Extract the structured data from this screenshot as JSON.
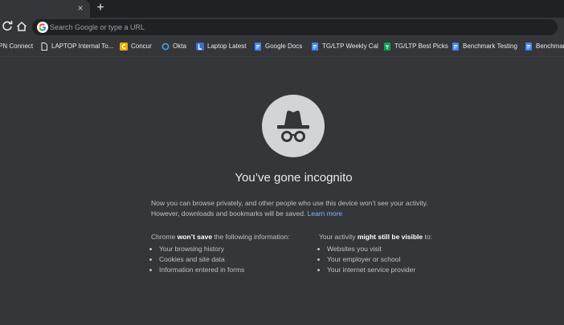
{
  "tabs": {
    "close_symbol": "×",
    "new_tab_symbol": "+"
  },
  "toolbar": {
    "omnibox_placeholder": "Search Google or type a URL",
    "icons": [
      "reload-icon",
      "home-icon",
      "google-icon"
    ]
  },
  "bookmarks": [
    {
      "label": "PN Connect",
      "icon": "none"
    },
    {
      "label": "LAPTOP Internal To...",
      "icon": "page-icon"
    },
    {
      "label": "Concur",
      "icon": "concur-icon"
    },
    {
      "label": "Okta",
      "icon": "okta-icon"
    },
    {
      "label": "Laptop Latest",
      "icon": "blue-l-icon"
    },
    {
      "label": "Google Docs",
      "icon": "docs-icon"
    },
    {
      "label": "TG/LTP Weekly Cal",
      "icon": "docs-icon"
    },
    {
      "label": "TG/LTP Best Picks",
      "icon": "sheets-icon"
    },
    {
      "label": "Benchmark Testing",
      "icon": "docs-icon"
    },
    {
      "label": "Benchmark",
      "icon": "docs-icon"
    }
  ],
  "content": {
    "title": "You’ve gone incognito",
    "description": "Now you can browse privately, and other people who use this device won’t see your activity. However, downloads and bookmarks will be saved.",
    "learn_more": "Learn more",
    "left": {
      "head_pre": "Chrome ",
      "head_bold": "won’t save",
      "head_post": " the following information:",
      "items": [
        "Your browsing history",
        "Cookies and site data",
        "Information entered in forms"
      ]
    },
    "right": {
      "head_pre": "Your activity ",
      "head_bold": "might still be visible",
      "head_post": " to:",
      "items": [
        "Websites you visit",
        "Your employer or school",
        "Your internet service provider"
      ]
    }
  },
  "colors": {
    "background": "#35363a",
    "tabstrip": "#202124",
    "link": "#8ab4f8",
    "icon_circle": "#d3d4d6"
  }
}
